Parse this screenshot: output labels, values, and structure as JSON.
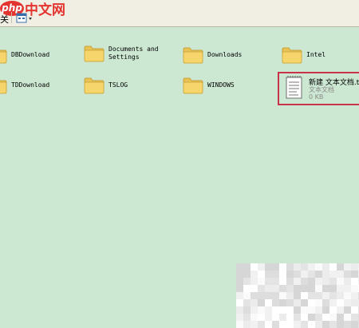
{
  "toolbar": {
    "close_label": "关",
    "view_button_icon": "views-icon",
    "brand_logo": {
      "badge": "php",
      "text": "中文网"
    }
  },
  "items": [
    {
      "name": "DBDownload",
      "icon": "folder-icon"
    },
    {
      "name": "Documents and\nSettings",
      "icon": "folder-icon"
    },
    {
      "name": "Downloads",
      "icon": "folder-icon"
    },
    {
      "name": "Intel",
      "icon": "folder-icon"
    },
    {
      "name": "TDDownload",
      "icon": "folder-icon"
    },
    {
      "name": "TSLOG",
      "icon": "folder-icon"
    },
    {
      "name": "WINDOWS",
      "icon": "folder-icon"
    }
  ],
  "selected_file": {
    "name": "新建 文本文档.t",
    "type": "文本文档",
    "size": "0 KB",
    "icon": "text-document-icon"
  },
  "colors": {
    "background": "#cde8d2",
    "selection_border": "#c8334a",
    "folder": "#f6d56a"
  }
}
